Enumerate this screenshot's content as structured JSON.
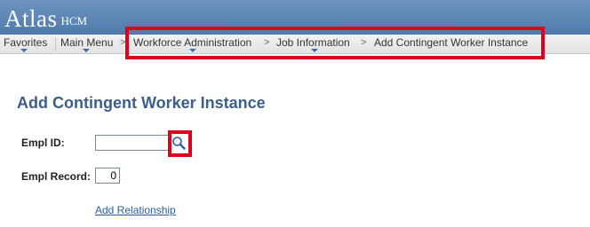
{
  "header": {
    "app_name": "Atlas",
    "app_sub": "HCM"
  },
  "nav": {
    "favorites": "Favorites",
    "main_menu": "Main Menu",
    "separator": ">",
    "breadcrumbs": [
      "Workforce Administration",
      "Job Information",
      "Add Contingent Worker Instance"
    ]
  },
  "page": {
    "title": "Add Contingent Worker Instance"
  },
  "form": {
    "empl_id_label": "Empl ID:",
    "empl_id_value": "",
    "empl_record_label": "Empl Record:",
    "empl_record_value": "0",
    "add_relationship_link": "Add Relationship"
  },
  "icons": {
    "lookup": "magnifier-icon",
    "dropdown": "triangle-down-icon"
  },
  "colors": {
    "header": "#5a84b5",
    "title": "#3b5f8a",
    "link": "#2c5e9e",
    "highlight": "#e0001b"
  }
}
